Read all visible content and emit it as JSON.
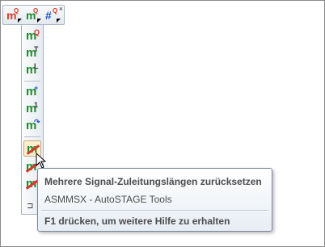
{
  "horizontal_toolbar": {
    "items": [
      {
        "letter": "m",
        "superscript": "Q",
        "icon": "m-red-q-icon"
      },
      {
        "letter": "m",
        "superscript": "Q",
        "icon": "m-green-q-icon"
      },
      {
        "letter": "#",
        "superscript": "Q",
        "icon": "hash-q-icon"
      }
    ],
    "close_glyph": "×"
  },
  "vertical_toolbar": {
    "items": [
      {
        "letter": "m",
        "mark": "Q",
        "icon": "m-q-icon"
      },
      {
        "letter": "m",
        "mark": "T",
        "icon": "m-t-icon"
      },
      {
        "letter": "m",
        "mark": "L",
        "icon": "m-l-icon"
      },
      {
        "letter": "m",
        "mark": "+",
        "icon": "m-plus-icon"
      },
      {
        "letter": "m",
        "mark": "1",
        "icon": "m-one-icon"
      },
      {
        "letter": "m",
        "mark": "↷",
        "icon": "m-rotate-icon"
      },
      {
        "letter": "m",
        "mark": "",
        "icon": "m-reset-lengths-icon"
      },
      {
        "letter": "m",
        "mark": "",
        "icon": "m-slash-icon"
      },
      {
        "letter": "m",
        "mark": "",
        "icon": "m-slash-2-icon"
      }
    ],
    "bottom_glyph": "⊐"
  },
  "tooltip": {
    "title": "Mehrere Signal-Zuleitungslängen zurücksetzen",
    "source": "ASMMSX - AutoSTAGE Tools",
    "help": "F1 drücken, um weitere Hilfe zu erhalten"
  },
  "colors": {
    "green": "#1f8c2a",
    "red": "#d83a2a",
    "blue": "#1e58c8"
  }
}
